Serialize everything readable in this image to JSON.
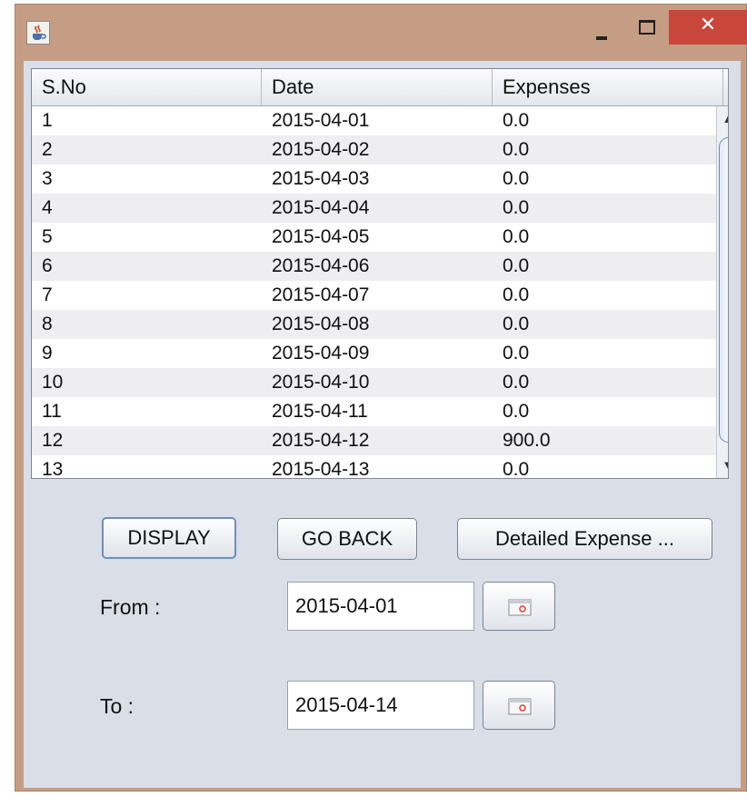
{
  "window": {
    "title_icon": "java-cup-icon",
    "minimize_icon": "minimize-icon",
    "maximize_icon": "maximize-icon",
    "close_label": "✕"
  },
  "table": {
    "columns": [
      "S.No",
      "Date",
      "Expenses"
    ],
    "rows": [
      [
        "1",
        "2015-04-01",
        "0.0"
      ],
      [
        "2",
        "2015-04-02",
        "0.0"
      ],
      [
        "3",
        "2015-04-03",
        "0.0"
      ],
      [
        "4",
        "2015-04-04",
        "0.0"
      ],
      [
        "5",
        "2015-04-05",
        "0.0"
      ],
      [
        "6",
        "2015-04-06",
        "0.0"
      ],
      [
        "7",
        "2015-04-07",
        "0.0"
      ],
      [
        "8",
        "2015-04-08",
        "0.0"
      ],
      [
        "9",
        "2015-04-09",
        "0.0"
      ],
      [
        "10",
        "2015-04-10",
        "0.0"
      ],
      [
        "11",
        "2015-04-11",
        "0.0"
      ],
      [
        "12",
        "2015-04-12",
        "900.0"
      ],
      [
        "13",
        "2015-04-13",
        "0.0"
      ]
    ]
  },
  "buttons": {
    "display": "DISPLAY",
    "go_back": "GO BACK",
    "detailed": "Detailed Expense ..."
  },
  "from": {
    "label": "From :",
    "value": "2015-04-01"
  },
  "to": {
    "label": "To :",
    "value": "2015-04-14"
  },
  "colors": {
    "window_frame": "#c49d84",
    "close_button": "#c9463d",
    "client_bg": "#d9dee7"
  }
}
